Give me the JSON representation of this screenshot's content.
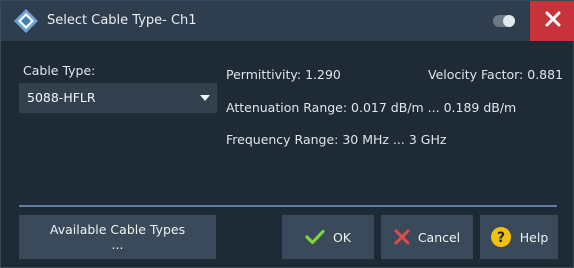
{
  "window": {
    "title": "Select Cable Type- Ch1",
    "colors": {
      "titlebar": "#2f3e4f",
      "background": "#1e2a36",
      "close": "#c8323a",
      "button": "#3a4a5a",
      "accent": "#5c7fa3"
    }
  },
  "cable": {
    "type_label": "Cable Type:",
    "selected_value": "5088-HFLR"
  },
  "info": {
    "permittivity": "Permittivity: 1.290",
    "velocity_factor": "Velocity Factor: 0.881",
    "attenuation_range": "Attenuation Range: 0.017 dB/m  ... 0.189 dB/m",
    "frequency_range": "Frequency Range:  30 MHz ... 3 GHz"
  },
  "buttons": {
    "available_line1": "Available Cable Types",
    "available_line2": "...",
    "ok": "OK",
    "cancel": "Cancel",
    "help": "Help"
  },
  "icons": {
    "logo": "rs-logo-icon",
    "toggle": "toggle-icon",
    "close": "close-icon",
    "ok": "check-icon",
    "cancel": "x-icon",
    "help": "help-icon"
  }
}
